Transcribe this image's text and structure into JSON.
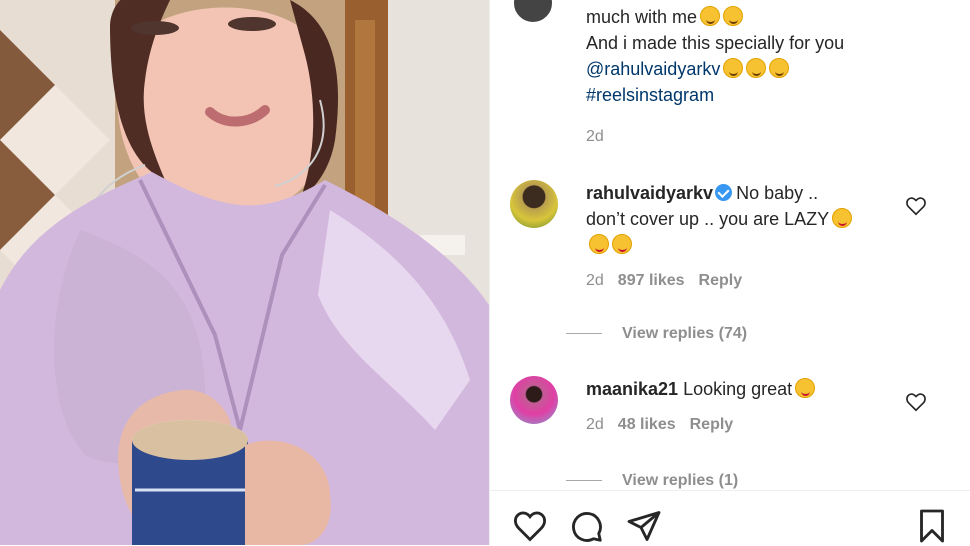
{
  "post": {
    "caption_lines": [
      "much with me",
      "And i made this specially for you",
      "@rahulvaidyarkv",
      "#reelsinstagram"
    ],
    "time": "2d"
  },
  "comments": [
    {
      "username": "rahulvaidyarkv",
      "verified": true,
      "text_line_1": "No baby ..",
      "text_line_2": "don’t cover up .. you are LAZY",
      "time": "2d",
      "likes": "897 likes",
      "reply": "Reply",
      "view_replies": "View replies (74)"
    },
    {
      "username": "maanika21",
      "text": "Looking great",
      "time": "2d",
      "likes": "48 likes",
      "reply": "Reply",
      "view_replies": "View replies (1)"
    }
  ],
  "icons": {
    "like": "heart-icon",
    "comment": "comment-icon",
    "share": "send-icon",
    "save": "bookmark-icon",
    "comment_like": "heart-outline-icon"
  },
  "colors": {
    "text": "#262626",
    "secondary_text": "#8e8e8e",
    "link": "#00376b",
    "verified": "#3897f0"
  }
}
